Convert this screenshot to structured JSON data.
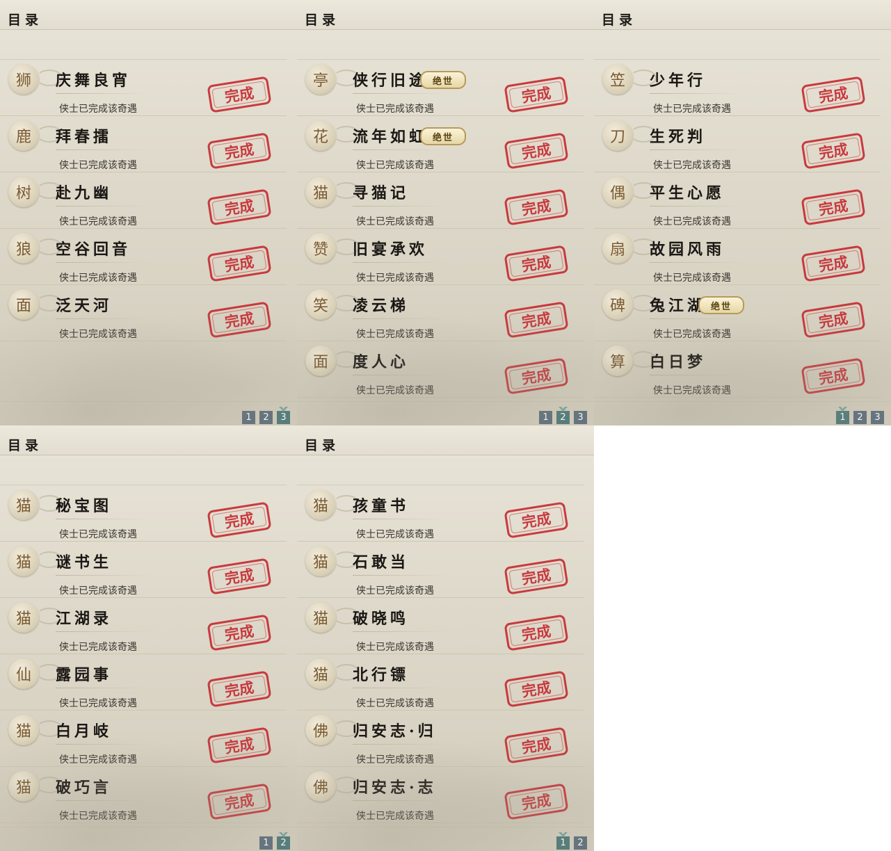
{
  "status_text": "侠士已完成该奇遇",
  "stamp_text": "完成",
  "badge_text": "绝世",
  "colors": {
    "stamp": "#c52028",
    "page_button": "#5f6f7c",
    "page_button_active": "#4f7a78"
  },
  "panels": [
    {
      "title": "目录",
      "pages": [
        "1",
        "2",
        "3"
      ],
      "active_page": "3",
      "items": [
        {
          "name": "庆舞良宵",
          "icon": "lion-dance-icon",
          "glyph": "狮",
          "completed": true,
          "legendary": false
        },
        {
          "name": "拜春擂",
          "icon": "kangaroo-icon",
          "glyph": "鹿",
          "completed": true,
          "legendary": false
        },
        {
          "name": "赴九幽",
          "icon": "red-tree-icon",
          "glyph": "树",
          "completed": true,
          "legendary": false
        },
        {
          "name": "空谷回音",
          "icon": "wolf-head-icon",
          "glyph": "狼",
          "completed": true,
          "legendary": false
        },
        {
          "name": "泛天河",
          "icon": "golden-mask-icon",
          "glyph": "面",
          "completed": true,
          "legendary": false
        }
      ]
    },
    {
      "title": "目录",
      "pages": [
        "1",
        "2",
        "3"
      ],
      "active_page": "2",
      "items": [
        {
          "name": "侠行旧途",
          "icon": "pavilion-icon",
          "glyph": "亭",
          "completed": true,
          "legendary": true
        },
        {
          "name": "流年如虹",
          "icon": "flower-icon",
          "glyph": "花",
          "completed": true,
          "legendary": true
        },
        {
          "name": "寻猫记",
          "icon": "cat-icon",
          "glyph": "猫",
          "completed": true,
          "legendary": false
        },
        {
          "name": "旧宴承欢",
          "icon": "thumbs-up-icon",
          "glyph": "赞",
          "completed": true,
          "legendary": false
        },
        {
          "name": "凌云梯",
          "icon": "smiley-icon",
          "glyph": "笑",
          "completed": true,
          "legendary": false
        },
        {
          "name": "度人心",
          "icon": "mask-icon",
          "glyph": "面",
          "completed": true,
          "legendary": false
        }
      ]
    },
    {
      "title": "目录",
      "pages": [
        "1",
        "2",
        "3"
      ],
      "active_page": "1",
      "items": [
        {
          "name": "少年行",
          "icon": "straw-hat-icon",
          "glyph": "笠",
          "completed": true,
          "legendary": false
        },
        {
          "name": "生死判",
          "icon": "sword-icon",
          "glyph": "刀",
          "completed": true,
          "legendary": false
        },
        {
          "name": "平生心愿",
          "icon": "doll-icon",
          "glyph": "偶",
          "completed": true,
          "legendary": false
        },
        {
          "name": "故园风雨",
          "icon": "fan-icon",
          "glyph": "扇",
          "completed": true,
          "legendary": false
        },
        {
          "name": "兔江湖",
          "icon": "tombstone-icon",
          "glyph": "碑",
          "completed": true,
          "legendary": true
        },
        {
          "name": "白日梦",
          "icon": "abacus-icon",
          "glyph": "算",
          "completed": true,
          "legendary": false
        }
      ]
    },
    {
      "title": "目录",
      "pages": [
        "1",
        "2"
      ],
      "active_page": "2",
      "items": [
        {
          "name": "秘宝图",
          "icon": "cat-face-icon",
          "glyph": "猫",
          "completed": true,
          "legendary": false
        },
        {
          "name": "谜书生",
          "icon": "cat-face-icon",
          "glyph": "猫",
          "completed": true,
          "legendary": false
        },
        {
          "name": "江湖录",
          "icon": "cat-face-icon",
          "glyph": "猫",
          "completed": true,
          "legendary": false
        },
        {
          "name": "露园事",
          "icon": "flower-fairy-icon",
          "glyph": "仙",
          "completed": true,
          "legendary": false
        },
        {
          "name": "白月岐",
          "icon": "cat-face-icon",
          "glyph": "猫",
          "completed": true,
          "legendary": false
        },
        {
          "name": "破巧言",
          "icon": "cat-face-icon",
          "glyph": "猫",
          "completed": true,
          "legendary": false
        }
      ]
    },
    {
      "title": "目录",
      "pages": [
        "1",
        "2"
      ],
      "active_page": "1",
      "items": [
        {
          "name": "孩童书",
          "icon": "cat-face-icon",
          "glyph": "猫",
          "completed": true,
          "legendary": false
        },
        {
          "name": "石敢当",
          "icon": "cat-face-icon",
          "glyph": "猫",
          "completed": true,
          "legendary": false
        },
        {
          "name": "破晓鸣",
          "icon": "cat-face-icon",
          "glyph": "猫",
          "completed": true,
          "legendary": false
        },
        {
          "name": "北行镖",
          "icon": "cat-face-icon",
          "glyph": "猫",
          "completed": true,
          "legendary": false
        },
        {
          "name": "归安志·归",
          "icon": "golden-statue-icon",
          "glyph": "佛",
          "completed": true,
          "legendary": false
        },
        {
          "name": "归安志·志",
          "icon": "golden-statue-icon",
          "glyph": "佛",
          "completed": true,
          "legendary": false
        }
      ]
    }
  ]
}
